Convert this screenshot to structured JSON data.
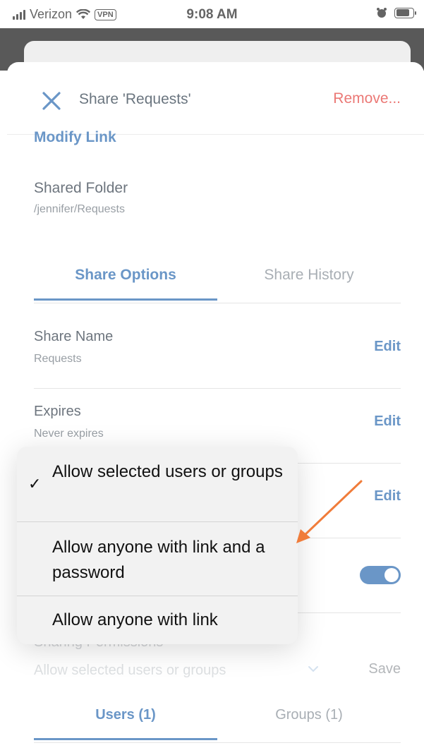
{
  "status_bar": {
    "carrier": "Verizon",
    "vpn": "VPN",
    "time": "9:08 AM"
  },
  "header": {
    "title": "Share 'Requests'",
    "remove_label": "Remove..."
  },
  "modify_link_label": "Modify Link",
  "shared_folder": {
    "title": "Shared Folder",
    "path": "/jennifer/Requests"
  },
  "tabs": {
    "share_options": "Share Options",
    "share_history": "Share History"
  },
  "rows": {
    "share_name": {
      "title": "Share Name",
      "value": "Requests",
      "action": "Edit"
    },
    "expires": {
      "title": "Expires",
      "value": "Never expires",
      "action": "Edit"
    },
    "access": {
      "action": "Edit"
    }
  },
  "toggle": {
    "on": true
  },
  "sharing_permissions": {
    "label": "Sharing Permissions",
    "value": "Allow selected users or groups",
    "save_label": "Save"
  },
  "bottom_tabs": {
    "users": "Users (1)",
    "groups": "Groups (1)"
  },
  "menu": {
    "items": [
      {
        "label": "Allow selected users or groups",
        "selected": true
      },
      {
        "label": "Allow anyone with link and a password",
        "selected": false
      },
      {
        "label": "Allow anyone with link",
        "selected": false
      }
    ]
  },
  "colors": {
    "accent": "#1b5fa9",
    "danger": "#e0312c",
    "arrow": "#f07c3a"
  }
}
